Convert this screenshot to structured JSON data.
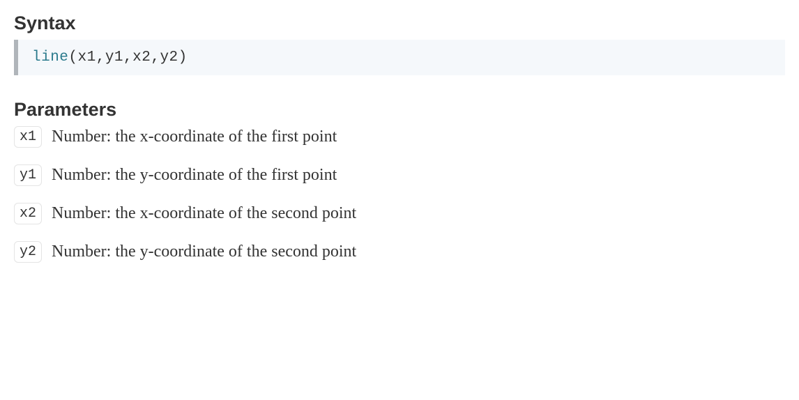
{
  "syntax": {
    "heading": "Syntax",
    "function_name": "line",
    "args_display": "(x1,y1,x2,y2)"
  },
  "parameters": {
    "heading": "Parameters",
    "items": [
      {
        "name": "x1",
        "description": "Number: the x-coordinate of the first point"
      },
      {
        "name": "y1",
        "description": "Number: the y-coordinate of the first point"
      },
      {
        "name": "x2",
        "description": "Number: the x-coordinate of the second point"
      },
      {
        "name": "y2",
        "description": "Number: the y-coordinate of the second point"
      }
    ]
  }
}
